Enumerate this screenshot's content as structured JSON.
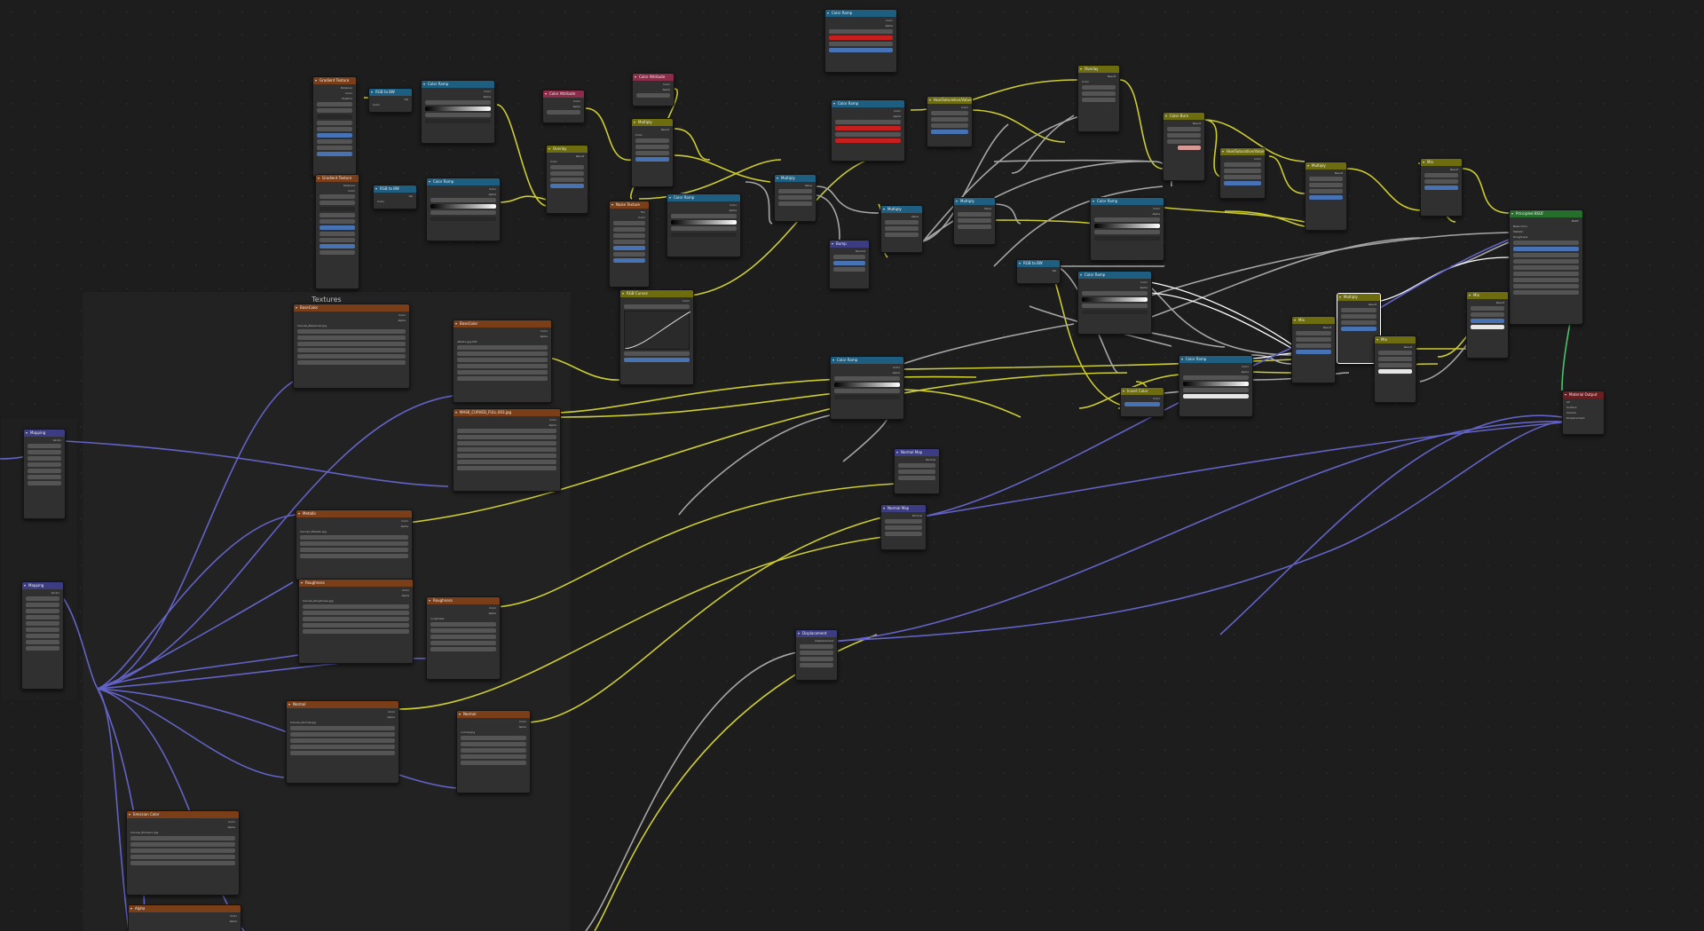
{
  "editor": {
    "frame_title": "Textures"
  },
  "colors": {
    "texture": "#7a3f18",
    "converter": "#1e5f81",
    "color": "#6d6d10",
    "vector": "#3c3c83",
    "shader": "#266e2c",
    "input": "#8a2c4a",
    "output": "#6a1e22"
  },
  "nodes": [
    {
      "id": "cr_top",
      "title": "Color Ramp",
      "cat": "converter",
      "labels": [
        "Color",
        "Alpha"
      ]
    },
    {
      "id": "gt1",
      "title": "Gradient Texture",
      "cat": "texture",
      "labels": [
        "Distance",
        "Color",
        "Position"
      ]
    },
    {
      "id": "sep1",
      "title": "RGB to BW",
      "cat": "converter",
      "labels": [
        "Val",
        "Color"
      ]
    },
    {
      "id": "cr1",
      "title": "Color Ramp",
      "cat": "converter",
      "labels": [
        "Color",
        "Alpha"
      ]
    },
    {
      "id": "gt2",
      "title": "Gradient Texture",
      "cat": "texture",
      "labels": [
        "Distance",
        "Color"
      ]
    },
    {
      "id": "sep2",
      "title": "RGB to BW",
      "cat": "converter",
      "labels": [
        "Val",
        "Color"
      ]
    },
    {
      "id": "cr2",
      "title": "Color Ramp",
      "cat": "converter",
      "labels": [
        "Color",
        "Alpha"
      ]
    },
    {
      "id": "cattr1",
      "title": "Color Attribute",
      "cat": "input",
      "labels": [
        "Color",
        "Alpha"
      ]
    },
    {
      "id": "cattr2",
      "title": "Color Attribute",
      "cat": "input",
      "labels": [
        "Color",
        "Alpha"
      ]
    },
    {
      "id": "ov1",
      "title": "Overlay",
      "cat": "color",
      "labels": [
        "Result",
        "Color"
      ]
    },
    {
      "id": "mul1",
      "title": "Multiply",
      "cat": "color",
      "labels": [
        "Result",
        "Color"
      ]
    },
    {
      "id": "noise",
      "title": "Noise Texture",
      "cat": "texture",
      "labels": [
        "Fac",
        "Color"
      ]
    },
    {
      "id": "cr3",
      "title": "Color Ramp",
      "cat": "converter",
      "labels": [
        "Color",
        "Alpha"
      ]
    },
    {
      "id": "rgbcurves",
      "title": "RGB Curves",
      "cat": "color",
      "labels": [
        "Color"
      ]
    },
    {
      "id": "cr_red",
      "title": "Color Ramp",
      "cat": "converter",
      "labels": [
        "Color",
        "Alpha"
      ]
    },
    {
      "id": "hsv1",
      "title": "Hue/Saturation/Value",
      "cat": "color",
      "labels": [
        "Color"
      ]
    },
    {
      "id": "ov2",
      "title": "Overlay",
      "cat": "color",
      "labels": [
        "Result",
        "Color"
      ]
    },
    {
      "id": "mul2",
      "title": "Multiply",
      "cat": "converter",
      "labels": [
        "Value"
      ]
    },
    {
      "id": "mul3",
      "title": "Multiply",
      "cat": "converter",
      "labels": [
        "Value"
      ]
    },
    {
      "id": "mul4",
      "title": "Multiply",
      "cat": "converter",
      "labels": [
        "Value"
      ]
    },
    {
      "id": "bump1",
      "title": "Bump",
      "cat": "vector",
      "labels": [
        "Normal"
      ]
    },
    {
      "id": "cbrn",
      "title": "Color Burn",
      "cat": "color",
      "labels": [
        "Result"
      ]
    },
    {
      "id": "hsv2",
      "title": "Hue/Saturation/Value",
      "cat": "color",
      "labels": [
        "Color"
      ]
    },
    {
      "id": "mul5",
      "title": "Multiply",
      "cat": "color",
      "labels": [
        "Result"
      ]
    },
    {
      "id": "mix1",
      "title": "Mix",
      "cat": "color",
      "labels": [
        "Result"
      ]
    },
    {
      "id": "cr4",
      "title": "Color Ramp",
      "cat": "converter",
      "labels": [
        "Color",
        "Alpha"
      ]
    },
    {
      "id": "rgbbw",
      "title": "RGB to BW",
      "cat": "converter",
      "labels": [
        "Val"
      ]
    },
    {
      "id": "cr5",
      "title": "Color Ramp",
      "cat": "converter",
      "labels": [
        "Color",
        "Alpha"
      ]
    },
    {
      "id": "bsdf",
      "title": "Principled BSDF",
      "cat": "shader",
      "labels": [
        "BSDF",
        "Base Color",
        "Metallic",
        "Roughness"
      ]
    },
    {
      "id": "mul6",
      "title": "Multiply",
      "cat": "color",
      "labels": [
        "Result"
      ]
    },
    {
      "id": "mix2",
      "title": "Mix",
      "cat": "color",
      "labels": [
        "Result"
      ]
    },
    {
      "id": "mix3",
      "title": "Mix",
      "cat": "color",
      "labels": [
        "Result"
      ]
    },
    {
      "id": "mix4",
      "title": "Mix",
      "cat": "color",
      "labels": [
        "Result"
      ]
    },
    {
      "id": "matout",
      "title": "Material Output",
      "cat": "output",
      "labels": [
        "All",
        "Surface",
        "Volume",
        "Displacement"
      ]
    },
    {
      "id": "basecolor",
      "title": "BaseColor",
      "cat": "texture",
      "labels": [
        "Color",
        "Alpha"
      ],
      "image": "Canvas_BaseColor.jpg"
    },
    {
      "id": "basecolor2",
      "title": "BaseColor",
      "cat": "texture",
      "labels": [
        "Color",
        "Alpha"
      ],
      "image": "albedo.jpg.003"
    },
    {
      "id": "mask",
      "title": "MASK_CURVED_FULL.003.jpg",
      "cat": "texture",
      "labels": [
        "Color",
        "Alpha"
      ]
    },
    {
      "id": "metallic",
      "title": "Metallic",
      "cat": "texture",
      "labels": [
        "Color",
        "Alpha"
      ],
      "image": "Canvas_Metallic.jpg"
    },
    {
      "id": "rough1",
      "title": "Roughness",
      "cat": "texture",
      "labels": [
        "Color",
        "Alpha"
      ],
      "image": "Canvas_Roughness.jpg"
    },
    {
      "id": "rough2",
      "title": "Roughness",
      "cat": "texture",
      "labels": [
        "Color",
        "Alpha"
      ],
      "image": "roughness"
    },
    {
      "id": "normal1",
      "title": "Normal",
      "cat": "texture",
      "labels": [
        "Color",
        "Alpha"
      ],
      "image": "Canvas_Normal.jpg"
    },
    {
      "id": "normal2",
      "title": "Normal",
      "cat": "texture",
      "labels": [
        "Color",
        "Alpha"
      ],
      "image": "normal.jpg"
    },
    {
      "id": "emission",
      "title": "Emission Color",
      "cat": "texture",
      "labels": [
        "Color",
        "Alpha"
      ],
      "image": "Canvas_Emission.jpg"
    },
    {
      "id": "alpha",
      "title": "Alpha",
      "cat": "texture",
      "labels": [
        "Color",
        "Alpha"
      ]
    },
    {
      "id": "mapping1",
      "title": "Mapping",
      "cat": "vector",
      "labels": [
        "Vector"
      ]
    },
    {
      "id": "mapping2",
      "title": "Mapping",
      "cat": "vector",
      "labels": [
        "Vector"
      ]
    },
    {
      "id": "cr6",
      "title": "Color Ramp",
      "cat": "converter",
      "labels": [
        "Color",
        "Alpha"
      ]
    },
    {
      "id": "nmap1",
      "title": "Normal Map",
      "cat": "vector",
      "labels": [
        "Normal"
      ]
    },
    {
      "id": "nmap2",
      "title": "Normal Map",
      "cat": "vector",
      "labels": [
        "Normal"
      ]
    },
    {
      "id": "disp",
      "title": "Displacement",
      "cat": "vector",
      "labels": [
        "Displacement"
      ]
    },
    {
      "id": "invert",
      "title": "Invert Color",
      "cat": "color",
      "labels": [
        "Color"
      ]
    },
    {
      "id": "cr7",
      "title": "Color Ramp",
      "cat": "converter",
      "labels": [
        "Color",
        "Alpha"
      ]
    }
  ]
}
